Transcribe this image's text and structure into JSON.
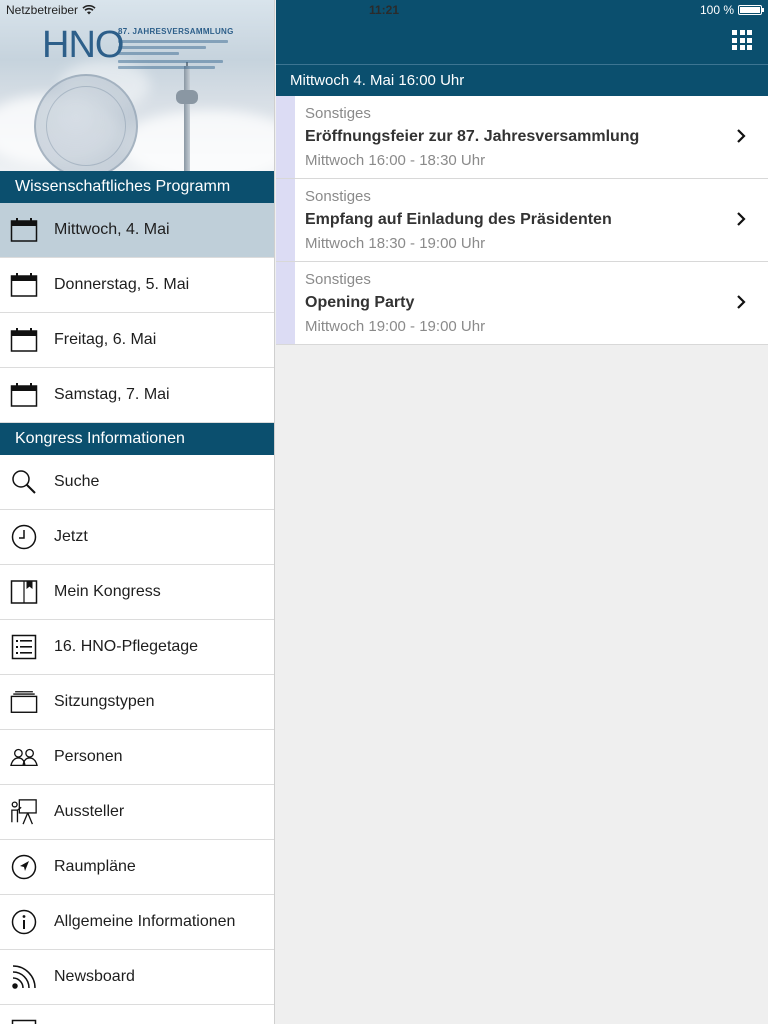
{
  "status_bar": {
    "carrier": "Netzbetreiber",
    "time": "11:21",
    "battery": "100 %",
    "battery_level": 1.0
  },
  "sidebar": {
    "section_program": "Wissenschaftliches Programm",
    "days": [
      {
        "label": "Mittwoch, 4. Mai",
        "icon": "calendar-icon",
        "active": true
      },
      {
        "label": "Donnerstag, 5. Mai",
        "icon": "calendar-icon",
        "active": false
      },
      {
        "label": "Freitag, 6. Mai",
        "icon": "calendar-icon",
        "active": false
      },
      {
        "label": "Samstag, 7. Mai",
        "icon": "calendar-icon",
        "active": false
      }
    ],
    "section_info": "Kongress Informationen",
    "info_items": [
      {
        "label": "Suche",
        "icon": "search-icon"
      },
      {
        "label": "Jetzt",
        "icon": "clock-icon"
      },
      {
        "label": "Mein Kongress",
        "icon": "bookmark-book-icon"
      },
      {
        "label": "16. HNO-Pflegetage",
        "icon": "list-icon"
      },
      {
        "label": "Sitzungstypen",
        "icon": "stack-icon"
      },
      {
        "label": "Personen",
        "icon": "people-icon"
      },
      {
        "label": "Aussteller",
        "icon": "presenter-icon"
      },
      {
        "label": "Raumpläne",
        "icon": "navigation-icon"
      },
      {
        "label": "Allgemeine Informationen",
        "icon": "info-icon"
      },
      {
        "label": "Newsboard",
        "icon": "rss-icon"
      }
    ]
  },
  "banner": {
    "logo_text": "HNO",
    "subtitle": "87. JAHRESVERSAMMLUNG"
  },
  "main": {
    "day_header": "Mittwoch 4. Mai 16:00 Uhr",
    "events": [
      {
        "category": "Sonstiges",
        "title": "Eröffnungsfeier zur 87. Jahresversammlung",
        "time": "Mittwoch 16:00 - 18:30 Uhr"
      },
      {
        "category": "Sonstiges",
        "title": "Empfang auf Einladung des Präsidenten",
        "time": "Mittwoch 18:30 - 19:00 Uhr"
      },
      {
        "category": "Sonstiges",
        "title": "Opening Party",
        "time": "Mittwoch 19:00 - 19:00 Uhr"
      }
    ]
  },
  "colors": {
    "accent": "#0b4f6e",
    "active_row": "#bfcfd9",
    "event_strip": "#dcdcf4"
  }
}
